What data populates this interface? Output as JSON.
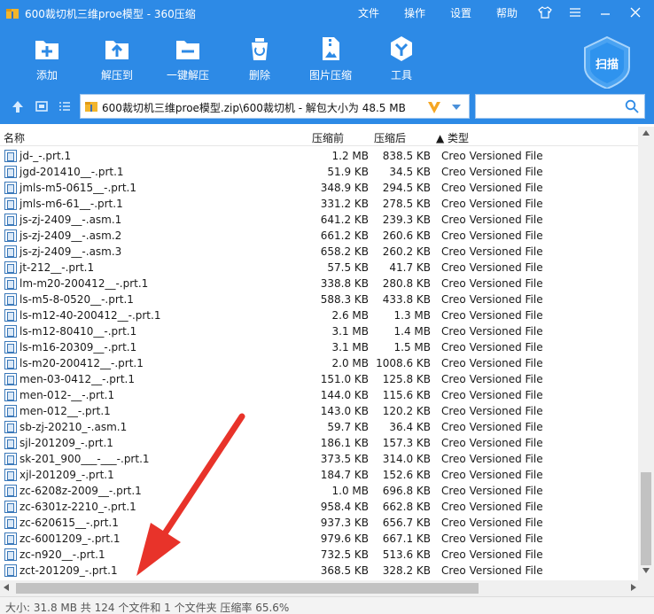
{
  "window": {
    "title": "600裁切机三维proe模型 - 360压缩",
    "menus": [
      "文件",
      "操作",
      "设置",
      "帮助"
    ]
  },
  "toolbar": {
    "tools": [
      {
        "label": "添加",
        "icon": "add-icon"
      },
      {
        "label": "解压到",
        "icon": "extract-to-icon"
      },
      {
        "label": "一键解压",
        "icon": "one-click-extract-icon"
      },
      {
        "label": "删除",
        "icon": "delete-icon"
      },
      {
        "label": "图片压缩",
        "icon": "image-compress-icon"
      },
      {
        "label": "工具",
        "icon": "tools-icon"
      }
    ],
    "scan_label": "扫描"
  },
  "address": {
    "path": "600裁切机三维proe模型.zip\\600裁切机 - 解包大小为 48.5 MB"
  },
  "columns": {
    "name": "名称",
    "compressed": "压缩前",
    "original": "压缩后",
    "type": "▲ 类型"
  },
  "files": [
    {
      "name": "jd-_-.prt.1",
      "compressed": "1.2 MB",
      "original": "838.5 KB",
      "type": "Creo Versioned File"
    },
    {
      "name": "jgd-201410__-.prt.1",
      "compressed": "51.9 KB",
      "original": "34.5 KB",
      "type": "Creo Versioned File"
    },
    {
      "name": "jmls-m5-0615__-.prt.1",
      "compressed": "348.9 KB",
      "original": "294.5 KB",
      "type": "Creo Versioned File"
    },
    {
      "name": "jmls-m6-61__-.prt.1",
      "compressed": "331.2 KB",
      "original": "278.5 KB",
      "type": "Creo Versioned File"
    },
    {
      "name": "js-zj-2409__-.asm.1",
      "compressed": "641.2 KB",
      "original": "239.3 KB",
      "type": "Creo Versioned File"
    },
    {
      "name": "js-zj-2409__-.asm.2",
      "compressed": "661.2 KB",
      "original": "260.6 KB",
      "type": "Creo Versioned File"
    },
    {
      "name": "js-zj-2409__-.asm.3",
      "compressed": "658.2 KB",
      "original": "260.2 KB",
      "type": "Creo Versioned File"
    },
    {
      "name": "jt-212__-.prt.1",
      "compressed": "57.5 KB",
      "original": "41.7 KB",
      "type": "Creo Versioned File"
    },
    {
      "name": "lm-m20-200412__-.prt.1",
      "compressed": "338.8 KB",
      "original": "280.8 KB",
      "type": "Creo Versioned File"
    },
    {
      "name": "ls-m5-8-0520__-.prt.1",
      "compressed": "588.3 KB",
      "original": "433.8 KB",
      "type": "Creo Versioned File"
    },
    {
      "name": "ls-m12-40-200412__-.prt.1",
      "compressed": "2.6 MB",
      "original": "1.3 MB",
      "type": "Creo Versioned File"
    },
    {
      "name": "ls-m12-80410__-.prt.1",
      "compressed": "3.1 MB",
      "original": "1.4 MB",
      "type": "Creo Versioned File"
    },
    {
      "name": "ls-m16-20309__-.prt.1",
      "compressed": "3.1 MB",
      "original": "1.5 MB",
      "type": "Creo Versioned File"
    },
    {
      "name": "ls-m20-200412__-.prt.1",
      "compressed": "2.0 MB",
      "original": "1008.6 KB",
      "type": "Creo Versioned File"
    },
    {
      "name": "men-03-0412__-.prt.1",
      "compressed": "151.0 KB",
      "original": "125.8 KB",
      "type": "Creo Versioned File"
    },
    {
      "name": "men-012-__-.prt.1",
      "compressed": "144.0 KB",
      "original": "115.6 KB",
      "type": "Creo Versioned File"
    },
    {
      "name": "men-012__-.prt.1",
      "compressed": "143.0 KB",
      "original": "120.2 KB",
      "type": "Creo Versioned File"
    },
    {
      "name": "sb-zj-20210_-.asm.1",
      "compressed": "59.7 KB",
      "original": "36.4 KB",
      "type": "Creo Versioned File"
    },
    {
      "name": "sjl-201209_-.prt.1",
      "compressed": "186.1 KB",
      "original": "157.3 KB",
      "type": "Creo Versioned File"
    },
    {
      "name": "sk-201_900___-___-.prt.1",
      "compressed": "373.5 KB",
      "original": "314.0 KB",
      "type": "Creo Versioned File"
    },
    {
      "name": "xjl-201209_-.prt.1",
      "compressed": "184.7 KB",
      "original": "152.6 KB",
      "type": "Creo Versioned File"
    },
    {
      "name": "zc-6208z-2009__-.prt.1",
      "compressed": "1.0 MB",
      "original": "696.8 KB",
      "type": "Creo Versioned File"
    },
    {
      "name": "zc-6301z-2210_-.prt.1",
      "compressed": "958.4 KB",
      "original": "662.8 KB",
      "type": "Creo Versioned File"
    },
    {
      "name": "zc-620615__-.prt.1",
      "compressed": "937.3 KB",
      "original": "656.7 KB",
      "type": "Creo Versioned File"
    },
    {
      "name": "zc-6001209_-.prt.1",
      "compressed": "979.6 KB",
      "original": "667.1 KB",
      "type": "Creo Versioned File"
    },
    {
      "name": "zc-n920__-.prt.1",
      "compressed": "732.5 KB",
      "original": "513.6 KB",
      "type": "Creo Versioned File"
    },
    {
      "name": "zct-201209_-.prt.1",
      "compressed": "368.5 KB",
      "original": "328.2 KB",
      "type": "Creo Versioned File"
    }
  ],
  "status": {
    "text": "大小: 31.8 MB 共 124 个文件和 1 个文件夹 压缩率 65.6%"
  },
  "colors": {
    "accent": "#2d8ae6",
    "annotation_arrow": "#e8332a"
  }
}
